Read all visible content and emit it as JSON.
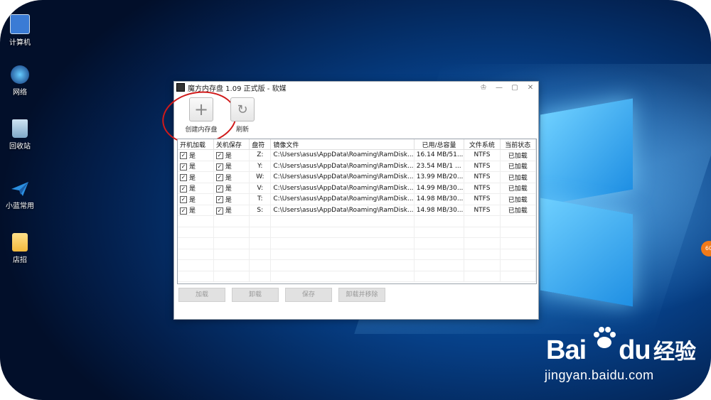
{
  "desktop": {
    "icons": [
      {
        "label": "计算机",
        "icon": "computer-icon"
      },
      {
        "label": "网络",
        "icon": "network-icon"
      },
      {
        "label": "回收站",
        "icon": "recycle-bin-icon"
      },
      {
        "label": "小蓝常用",
        "icon": "paper-plane-icon"
      },
      {
        "label": "店招",
        "icon": "folder-icon"
      }
    ]
  },
  "window": {
    "title": "魔方内存盘 1.09 正式版 - 软媒",
    "controls": [
      "skin",
      "minimize",
      "maximize",
      "close"
    ],
    "toolbar": {
      "create_label": "创建内存盘",
      "refresh_label": "刷新"
    },
    "table": {
      "headers": [
        "开机加载",
        "关机保存",
        "盘符",
        "镜像文件",
        "已用/总容量",
        "文件系统",
        "当前状态"
      ],
      "rows": [
        {
          "load": "是",
          "save": "是",
          "drive": "Z:",
          "image": "C:\\Users\\asus\\AppData\\Roaming\\RamDisk...",
          "usage": "16.14 MB/51...",
          "fs": "NTFS",
          "status": "已加载"
        },
        {
          "load": "是",
          "save": "是",
          "drive": "Y:",
          "image": "C:\\Users\\asus\\AppData\\Roaming\\RamDisk...",
          "usage": "23.54 MB/1 ...",
          "fs": "NTFS",
          "status": "已加载"
        },
        {
          "load": "是",
          "save": "是",
          "drive": "W:",
          "image": "C:\\Users\\asus\\AppData\\Roaming\\RamDisk...",
          "usage": "13.99 MB/20...",
          "fs": "NTFS",
          "status": "已加载"
        },
        {
          "load": "是",
          "save": "是",
          "drive": "V:",
          "image": "C:\\Users\\asus\\AppData\\Roaming\\RamDisk...",
          "usage": "14.99 MB/30...",
          "fs": "NTFS",
          "status": "已加载"
        },
        {
          "load": "是",
          "save": "是",
          "drive": "T:",
          "image": "C:\\Users\\asus\\AppData\\Roaming\\RamDisk...",
          "usage": "14.98 MB/30...",
          "fs": "NTFS",
          "status": "已加载"
        },
        {
          "load": "是",
          "save": "是",
          "drive": "S:",
          "image": "C:\\Users\\asus\\AppData\\Roaming\\RamDisk...",
          "usage": "14.98 MB/30...",
          "fs": "NTFS",
          "status": "已加载"
        }
      ]
    },
    "buttons": {
      "load": "加载",
      "unload": "卸载",
      "save": "保存",
      "unload_remove": "卸载并移除"
    }
  },
  "watermark": {
    "brand_bai": "Bai",
    "brand_du": "du",
    "brand_cn": "经验",
    "url": "jingyan.baidu.com"
  },
  "colors": {
    "annotation_circle": "#d01a1a",
    "desktop_blue": "#063f86"
  }
}
